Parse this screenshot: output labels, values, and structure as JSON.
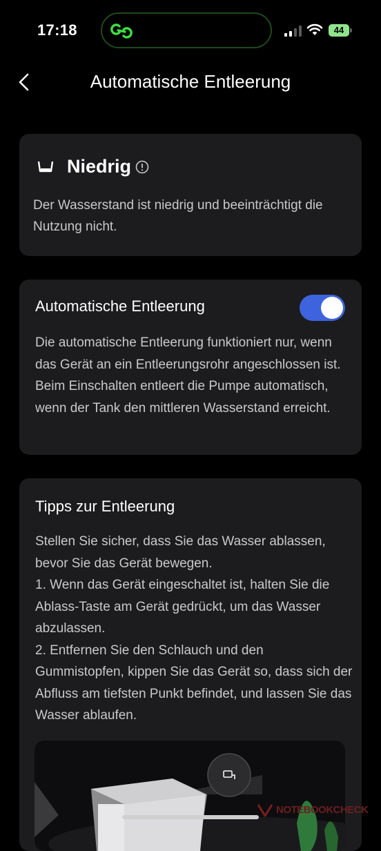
{
  "status_bar": {
    "time": "17:18",
    "battery": "44",
    "icons": [
      "activity-link-icon",
      "cellular-signal-icon",
      "wifi-icon",
      "battery-charging-icon"
    ]
  },
  "nav": {
    "back_icon": "chevron-left-icon",
    "title": "Automatische Entleerung"
  },
  "water_level": {
    "icon": "water-tank-icon",
    "title": "Niedrig",
    "info_icon": "info-circle-icon",
    "description": "Der Wasserstand ist niedrig und beeinträchtigt die Nutzung nicht."
  },
  "auto_drain": {
    "title": "Automatische Entleerung",
    "enabled": true,
    "description": "Die automatische Entleerung funktioniert nur, wenn das Gerät an ein Entleerungsrohr angeschlossen ist. Beim Einschalten entleert die Pumpe automatisch, wenn der Tank den mittleren Wasserstand erreicht."
  },
  "tips": {
    "title": "Tipps zur Entleerung",
    "paragraphs": [
      "Stellen Sie sicher, dass Sie das Wasser ablassen, bevor Sie das Gerät bewegen.",
      "1. Wenn das Gerät eingeschaltet ist, halten Sie die Ablass-Taste am Gerät gedrückt, um das Wasser abzulassen.",
      "2. Entfernen Sie den Schlauch und den Gummistopfen, kippen Sie das Gerät so, dass sich der Abfluss am tiefsten Punkt befindet, und lassen Sie das Wasser ablaufen."
    ]
  },
  "watermark": "NOTEBOOKCHECK",
  "colors": {
    "background": "#000000",
    "card": "#1c1c1e",
    "toggle_on": "#3d63dd",
    "text_secondary": "#c9c9cc",
    "island_accent": "#35d13a"
  }
}
